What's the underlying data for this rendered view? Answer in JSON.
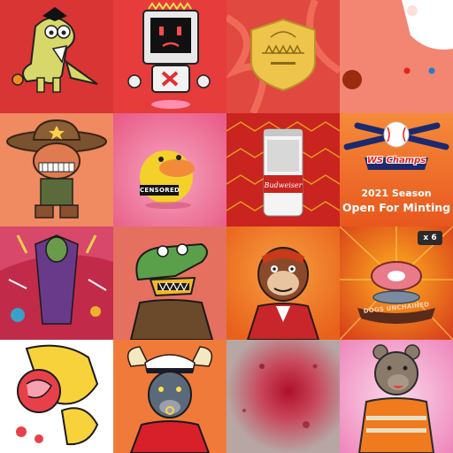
{
  "tiles": [
    {
      "name": "dino-skater",
      "bg": "#d93535"
    },
    {
      "name": "robot-tv",
      "bg": "#e63c3c"
    },
    {
      "name": "shield-badge",
      "bg": "#e04840"
    },
    {
      "name": "abstract-salmon",
      "bg": "#f28672"
    },
    {
      "name": "sheriff-character",
      "bg": "#f08a60"
    },
    {
      "name": "duck-censored",
      "bg": "#ee6d92",
      "label": "CENSORED"
    },
    {
      "name": "budweiser-can",
      "bg": "#c9241f",
      "can_text": "Budweiser"
    },
    {
      "name": "ws-champs-season",
      "bg": "#f06b30",
      "champs_text": "WS Champs",
      "line1": "2021 Season",
      "line2": "Open For Minting"
    },
    {
      "name": "collage-art",
      "bg": "#c22a4a"
    },
    {
      "name": "crocodile-frog",
      "bg": "#e57060"
    },
    {
      "name": "ape-character",
      "bg": "#f07a2a"
    },
    {
      "name": "steak-dogs-unchained",
      "bg": "#e8561a",
      "multiplier": "x 6",
      "banner": "DOGS UNCHAINED"
    },
    {
      "name": "cartoon-hand",
      "bg": "#ffffff"
    },
    {
      "name": "bull-captain",
      "bg": "#f07a3a"
    },
    {
      "name": "textured-red",
      "bg": "#b89a98"
    },
    {
      "name": "bear-worker",
      "bg": "#f3a6c8"
    }
  ]
}
